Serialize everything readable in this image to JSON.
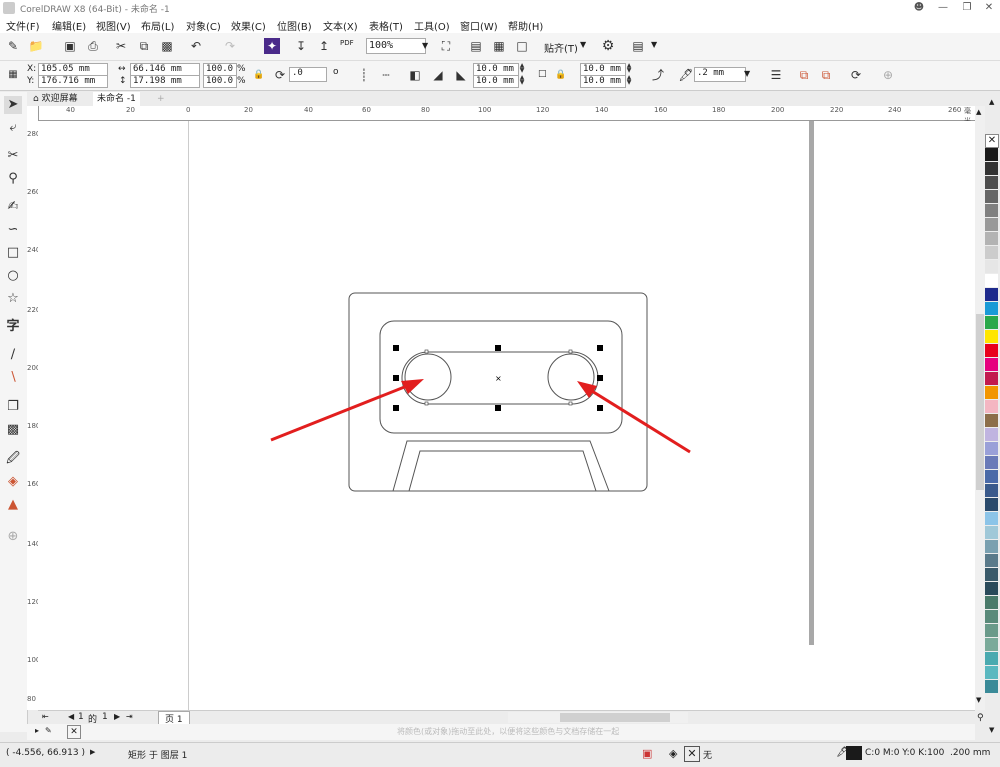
{
  "window": {
    "title": "CorelDRAW X8 (64-Bit) - 未命名 -1"
  },
  "menu": [
    "文件(F)",
    "编辑(E)",
    "视图(V)",
    "布局(L)",
    "对象(C)",
    "效果(C)",
    "位图(B)",
    "文本(X)",
    "表格(T)",
    "工具(O)",
    "窗口(W)",
    "帮助(H)"
  ],
  "toolbar1": {
    "zoom": "100%",
    "snap": "贴齐(T)",
    "pdf": "PDF"
  },
  "toolbar2": {
    "x": "105.05 mm",
    "y": "176.716 mm",
    "x_label": "X:",
    "y_label": "Y:",
    "w": "66.146 mm",
    "h": "17.198 mm",
    "sx": "100.0",
    "sy": "100.0",
    "pct": "%",
    "rot": ".0",
    "deg": "o",
    "corner1": "10.0 mm",
    "corner2": "10.0 mm",
    "corner3": "10.0 mm",
    "corner4": "10.0 mm",
    "outline": ".2 mm"
  },
  "tabs": {
    "welcome": "欢迎屏幕",
    "doc": "未命名 -1",
    "add": "+"
  },
  "ruler_h": {
    "labels": [
      "40",
      "20",
      "0",
      "20",
      "40",
      "60",
      "80",
      "100",
      "120",
      "140",
      "160",
      "180",
      "200",
      "220",
      "240",
      "260"
    ],
    "unit": "毫米"
  },
  "ruler_v": {
    "labels": [
      "280",
      "260",
      "240",
      "220",
      "200",
      "180",
      "160",
      "140",
      "120",
      "100",
      "80"
    ]
  },
  "pages": {
    "current": "1",
    "of": "的",
    "total": "1",
    "tab": "页 1"
  },
  "status": {
    "coords": "( -4.556, 66.913 )",
    "object": "矩形 于 图层 1",
    "hint": "将颜色(或对象)拖动至此处，以便将这些颜色与文档存储在一起",
    "fill": "无",
    "outline_color": "C:0 M:0 Y:0 K:100",
    "outline_width": ".200 mm"
  },
  "colors": {
    "arrow": "#e21e1e",
    "accent": "#4a2a8a"
  },
  "palette": [
    "#1a1a1a",
    "#333333",
    "#4d4d4d",
    "#666666",
    "#808080",
    "#999999",
    "#b3b3b3",
    "#cccccc",
    "#e6e6e6",
    "#ffffff",
    "#1e2a8c",
    "#1a9ad6",
    "#2aa84a",
    "#ffe600",
    "#e8001c",
    "#e6007e",
    "#c21a4e",
    "#f29600",
    "#f4b6c2",
    "#8c6e4a",
    "#c0b4e0",
    "#9aa0d8",
    "#6a7ab8",
    "#4a6aa8",
    "#3a5a8c",
    "#2a4a6c",
    "#8cc4e8",
    "#a0c8d8",
    "#7aa0b0",
    "#5a7a8a",
    "#3a5a6a",
    "#2a4a5a",
    "#4a7a6a",
    "#5a8a7a",
    "#6a9a8a",
    "#7aaa9a",
    "#4aaab0",
    "#5ab8c0",
    "#3a8a98"
  ]
}
